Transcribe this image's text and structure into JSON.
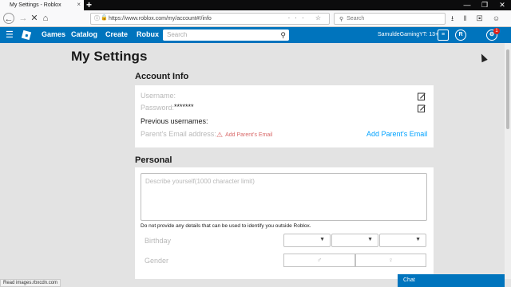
{
  "browser": {
    "tab_title": "My Settings - Roblox",
    "tab_close": "×",
    "new_tab": "+",
    "window_controls": [
      "—",
      "❐",
      "✕"
    ],
    "url": "https://www.roblox.com/my/account#!/info",
    "search_placeholder": "Search",
    "status_url": "Read images.rbxcdn.com"
  },
  "header": {
    "nav": [
      "Games",
      "Catalog",
      "Create",
      "Robux"
    ],
    "search_placeholder": "Search",
    "username": "SamuldeGamingYT: 13+",
    "notification_count": "1",
    "accent_color": "#0074bd"
  },
  "page": {
    "title": "My Settings"
  },
  "account_info": {
    "title": "Account Info",
    "username_label": "Username:",
    "password_label": "Password:",
    "password_value": "*******",
    "previous_usernames_label": "Previous usernames:",
    "parent_email_label": "Parent's Email address:",
    "parent_email_warning": "Add Parent's Email",
    "add_parent_email_link": "Add Parent's Email"
  },
  "personal": {
    "title": "Personal",
    "description_placeholder": "Describe yourself(1000 character limit)",
    "privacy_hint": "Do not provide any details that can be used to identify you outside Roblox.",
    "birthday_label": "Birthday",
    "gender_label": "Gender"
  },
  "chat": {
    "label": "Chat"
  }
}
